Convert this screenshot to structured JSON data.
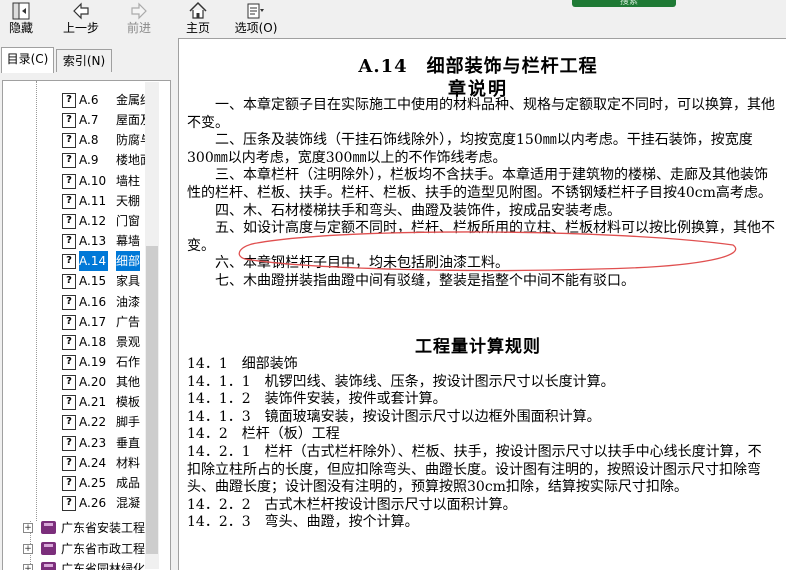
{
  "toolbar": {
    "hide": "隐藏",
    "back": "上一步",
    "forward": "前进",
    "home": "主页",
    "options": "选项(O)",
    "search": "搜索"
  },
  "tabs": {
    "contents": "目录(C)",
    "index": "索引(N)"
  },
  "tree": {
    "items": [
      {
        "num": "A.6",
        "title": "金属结"
      },
      {
        "num": "A.7",
        "title": "屋面及"
      },
      {
        "num": "A.8",
        "title": "防腐与"
      },
      {
        "num": "A.9",
        "title": "楼地面"
      },
      {
        "num": "A.10",
        "title": "墙柱"
      },
      {
        "num": "A.11",
        "title": "天棚"
      },
      {
        "num": "A.12",
        "title": "门窗"
      },
      {
        "num": "A.13",
        "title": "幕墙"
      },
      {
        "num": "A.14",
        "title": "细部"
      },
      {
        "num": "A.15",
        "title": "家具"
      },
      {
        "num": "A.16",
        "title": "油漆"
      },
      {
        "num": "A.17",
        "title": "广告"
      },
      {
        "num": "A.18",
        "title": "景观"
      },
      {
        "num": "A.19",
        "title": "石作"
      },
      {
        "num": "A.20",
        "title": "其他"
      },
      {
        "num": "A.21",
        "title": "模板"
      },
      {
        "num": "A.22",
        "title": "脚手"
      },
      {
        "num": "A.23",
        "title": "垂直"
      },
      {
        "num": "A.24",
        "title": "材料"
      },
      {
        "num": "A.25",
        "title": "成品"
      },
      {
        "num": "A.26",
        "title": "混凝"
      }
    ],
    "selected_index": 8,
    "books": [
      {
        "title": "广东省安装工程"
      },
      {
        "title": "广东省市政工程"
      },
      {
        "title": "广东省园林绿化"
      }
    ]
  },
  "document": {
    "title": "A.14　细部装饰与栏杆工程",
    "subtitle": "章说明",
    "notes": [
      "一、本章定额子目在实际施工中使用的材料品种、规格与定额取定不同时，可以换算，其他不变。",
      "二、压条及装饰线（干挂石饰线除外），均按宽度150㎜以内考虑。干挂石装饰，按宽度300㎜以内考虑，宽度300㎜以上的不作饰线考虑。",
      "三、本章栏杆（注明除外），栏板均不含扶手。本章适用于建筑物的楼梯、走廊及其他装饰性的栏杆、栏板、扶手。栏杆、栏板、扶手的造型见附图。不锈钢矮栏杆子目按40cm高考虑。",
      "四、木、石材楼梯扶手和弯头、曲蹬及装饰件，按成品安装考虑。",
      "五、如设计高度与定额不同时，栏杆、栏板所用的立柱、栏板材料可以按比例换算，其他不变。",
      "六、本章钢栏杆子目中，均未包括刷油漆工料。",
      "七、木曲蹬拼装指曲蹬中间有驳缝，整装是指整个中间不能有驳口。"
    ],
    "rules_title": "工程量计算规则",
    "rules": [
      "14．1　细部装饰",
      "14．1．1　机锣凹线、装饰线、压条，按设计图示尺寸以长度计算。",
      "14．1．2　装饰件安装，按件或套计算。",
      "14．1．3　镜面玻璃安装，按设计图示尺寸以边框外围面积计算。",
      "14．2　栏杆（板）工程",
      "14．2．1　栏杆（古式栏杆除外）、栏板、扶手，按设计图示尺寸以扶手中心线长度计算，不扣除立柱所占的长度，但应扣除弯头、曲蹬长度。设计图有注明的，按照设计图示尺寸扣除弯头、曲蹬长度；设计图没有注明的，预算按照30cm扣除，结算按实际尺寸扣除。",
      "14．2．2　古式木栏杆按设计图示尺寸以面积计算。",
      "14．2．3　弯头、曲蹬，按个计算。"
    ]
  },
  "colors": {
    "selection": "#0078d7",
    "annotation": "#e05050",
    "search_button": "#1f7a35"
  }
}
